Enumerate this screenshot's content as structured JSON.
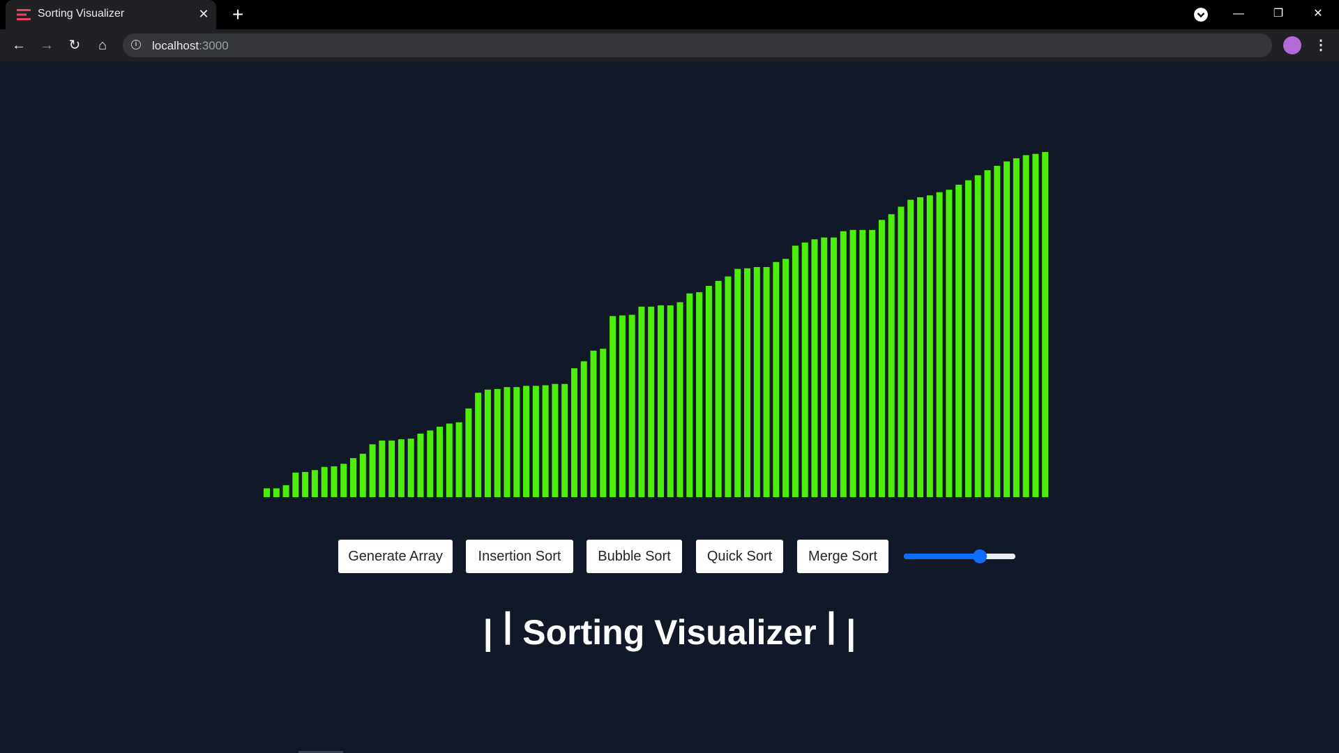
{
  "browser": {
    "tab_title": "Sorting Visualizer",
    "address_host": "localhost",
    "address_port": ":3000",
    "accent": "#4c8df6"
  },
  "controls": {
    "generate_label": "Generate Array",
    "insertion_label": "Insertion Sort",
    "bubble_label": "Bubble Sort",
    "quick_label": "Quick Sort",
    "merge_label": "Merge Sort",
    "speed_value": 0.68
  },
  "heading": "| ꟾ Sorting Visualizer ꟾ |",
  "colors": {
    "bar": "#4dee0a",
    "background": "#111827"
  },
  "chart_data": {
    "type": "bar",
    "values": [
      14,
      14,
      19,
      39,
      40,
      43,
      48,
      49,
      53,
      62,
      69,
      84,
      90,
      90,
      92,
      93,
      101,
      106,
      112,
      117,
      119,
      141,
      166,
      171,
      172,
      175,
      175,
      177,
      177,
      178,
      180,
      180,
      205,
      216,
      233,
      236,
      288,
      289,
      290,
      303,
      303,
      305,
      305,
      310,
      324,
      326,
      336,
      344,
      351,
      363,
      364,
      366,
      366,
      374,
      379,
      400,
      405,
      410,
      413,
      413,
      423,
      425,
      425,
      425,
      441,
      450,
      462,
      473,
      477,
      480,
      485,
      489,
      497,
      504,
      512,
      520,
      527,
      534,
      539,
      544,
      546,
      549
    ]
  }
}
